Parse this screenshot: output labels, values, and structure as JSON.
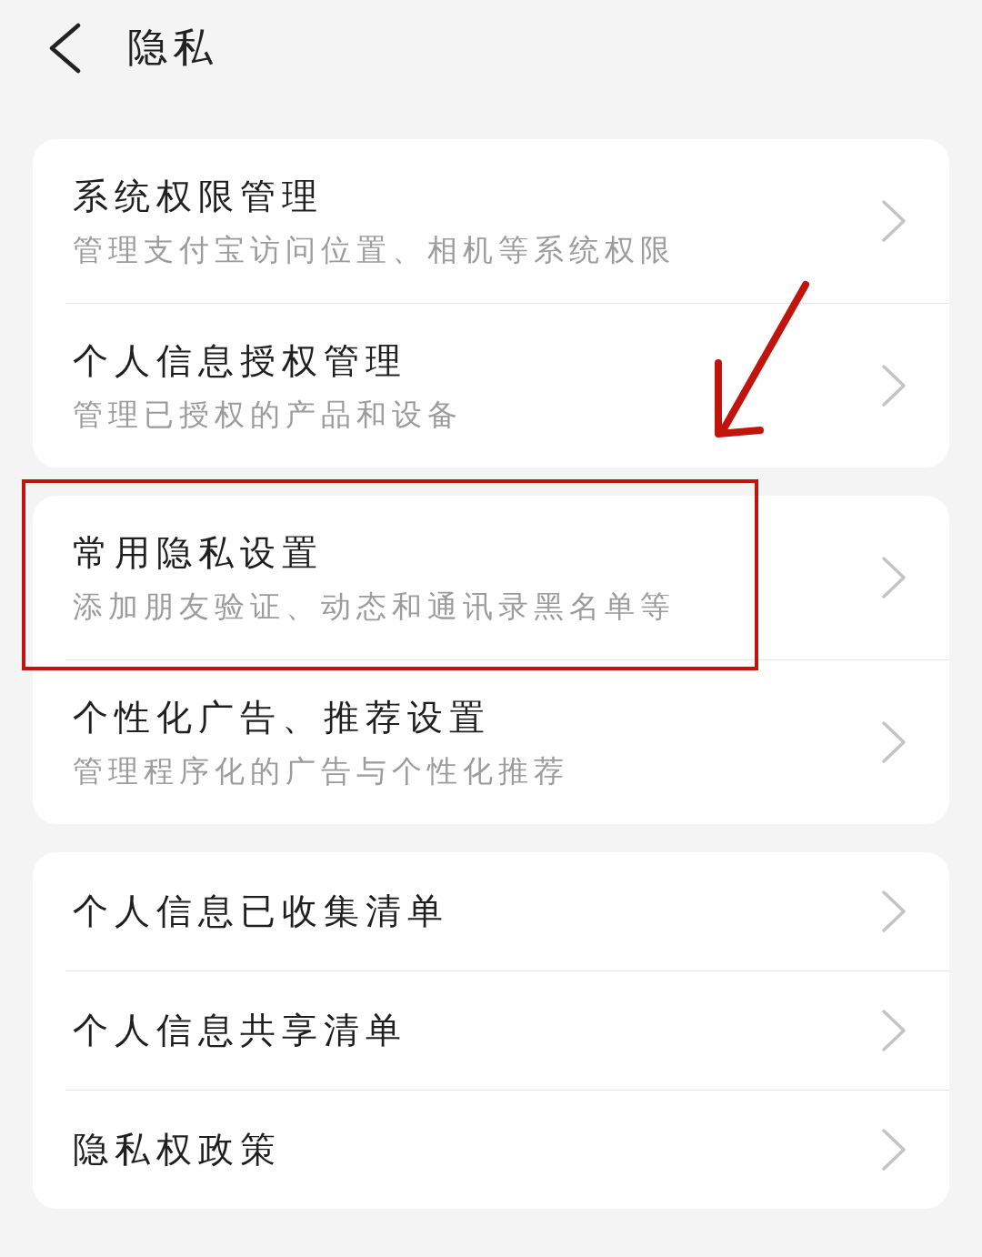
{
  "header": {
    "title": "隐私"
  },
  "groups": [
    {
      "items": [
        {
          "title": "系统权限管理",
          "subtitle": "管理支付宝访问位置、相机等系统权限"
        },
        {
          "title": "个人信息授权管理",
          "subtitle": "管理已授权的产品和设备"
        }
      ]
    },
    {
      "items": [
        {
          "title": "常用隐私设置",
          "subtitle": "添加朋友验证、动态和通讯录黑名单等",
          "highlighted": true
        },
        {
          "title": "个性化广告、推荐设置",
          "subtitle": "管理程序化的广告与个性化推荐"
        }
      ]
    },
    {
      "items": [
        {
          "title": "个人信息已收集清单"
        },
        {
          "title": "个人信息共享清单"
        },
        {
          "title": "隐私权政策"
        }
      ]
    }
  ]
}
